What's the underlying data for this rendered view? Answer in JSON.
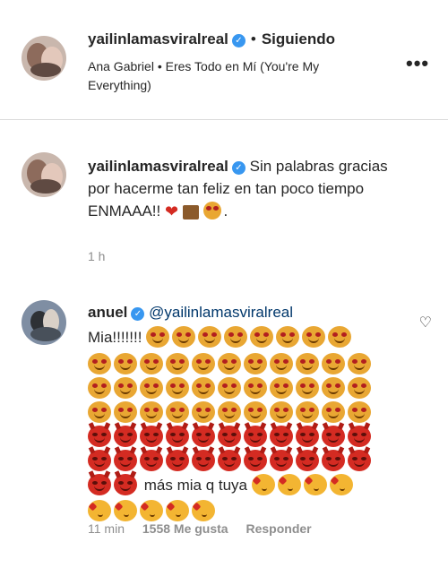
{
  "post": {
    "username": "yailinlamasviralreal",
    "separator": "•",
    "follow_status": "Siguiendo",
    "audio": "Ana Gabriel • Eres Todo en Mí (You're My Everything)",
    "more_icon": "more-horizontal-icon",
    "more_label": "•••"
  },
  "caption": {
    "username": "yailinlamasviralreal",
    "text": "Sin palabras gracias por hacerme tan feliz en tan poco tiempo ENMAAA!!",
    "emojis": [
      "red-heart",
      "couple-with-heart",
      "heart-eyes"
    ],
    "trailing": ".",
    "time": "1 h"
  },
  "comment": {
    "username": "anuel",
    "mention": "@yailinlamasviralreal",
    "text_start": "Mia!!!!!!!",
    "text_middle": "más mia q tuya",
    "time": "11 min",
    "likes": "1558 Me gusta",
    "reply_label": "Responder",
    "like_icon": "heart-outline-icon",
    "emoji_rows": [
      [
        "heart-eyes",
        "heart-eyes",
        "heart-eyes",
        "heart-eyes",
        "heart-eyes",
        "heart-eyes",
        "heart-eyes",
        "heart-eyes",
        "heart-eyes",
        "heart-eyes",
        "heart-eyes"
      ],
      [
        "heart-eyes",
        "heart-eyes",
        "heart-eyes",
        "heart-eyes",
        "heart-eyes",
        "heart-eyes",
        "heart-eyes",
        "heart-eyes",
        "heart-eyes",
        "heart-eyes",
        "heart-eyes"
      ],
      [
        "heart-eyes",
        "heart-eyes",
        "heart-eyes",
        "heart-eyes",
        "heart-eyes",
        "heart-eyes",
        "heart-eyes",
        "heart-eyes",
        "heart-eyes",
        "heart-eyes",
        "heart-eyes"
      ],
      [
        "devil",
        "devil",
        "devil",
        "devil",
        "devil",
        "devil",
        "devil",
        "devil",
        "devil",
        "devil",
        "devil"
      ],
      [
        "devil",
        "devil",
        "devil",
        "devil",
        "devil",
        "devil",
        "devil",
        "devil",
        "devil",
        "devil",
        "devil"
      ]
    ],
    "emoji_after_text": [
      "kiss",
      "kiss",
      "kiss",
      "kiss"
    ],
    "emoji_last_row": [
      "kiss",
      "kiss",
      "kiss",
      "kiss",
      "kiss"
    ]
  },
  "colors": {
    "text": "#262626",
    "secondary": "#8e8e8e",
    "verified": "#3897f0",
    "mention": "#00376b",
    "border": "#dbdbdb"
  }
}
